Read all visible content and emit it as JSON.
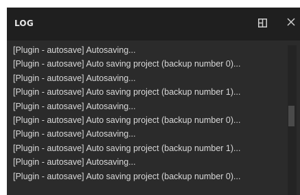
{
  "panel": {
    "title": "LOG",
    "icons": {
      "layout": "panel-layout-icon",
      "close": "close-icon"
    }
  },
  "log": {
    "lines": [
      "[Plugin - autosave] Autosaving...",
      "[Plugin - autosave] Auto saving project (backup number 0)...",
      "[Plugin - autosave] Autosaving...",
      "[Plugin - autosave] Auto saving project (backup number 1)...",
      "[Plugin - autosave] Autosaving...",
      "[Plugin - autosave] Auto saving project (backup number 0)...",
      "[Plugin - autosave] Autosaving...",
      "[Plugin - autosave] Auto saving project (backup number 1)...",
      "[Plugin - autosave] Autosaving...",
      "[Plugin - autosave] Auto saving project (backup number 0)..."
    ]
  },
  "colors": {
    "panel_bg": "#2b2b2b",
    "header_bg": "#1f1f1f",
    "text": "#d9d9d9"
  }
}
